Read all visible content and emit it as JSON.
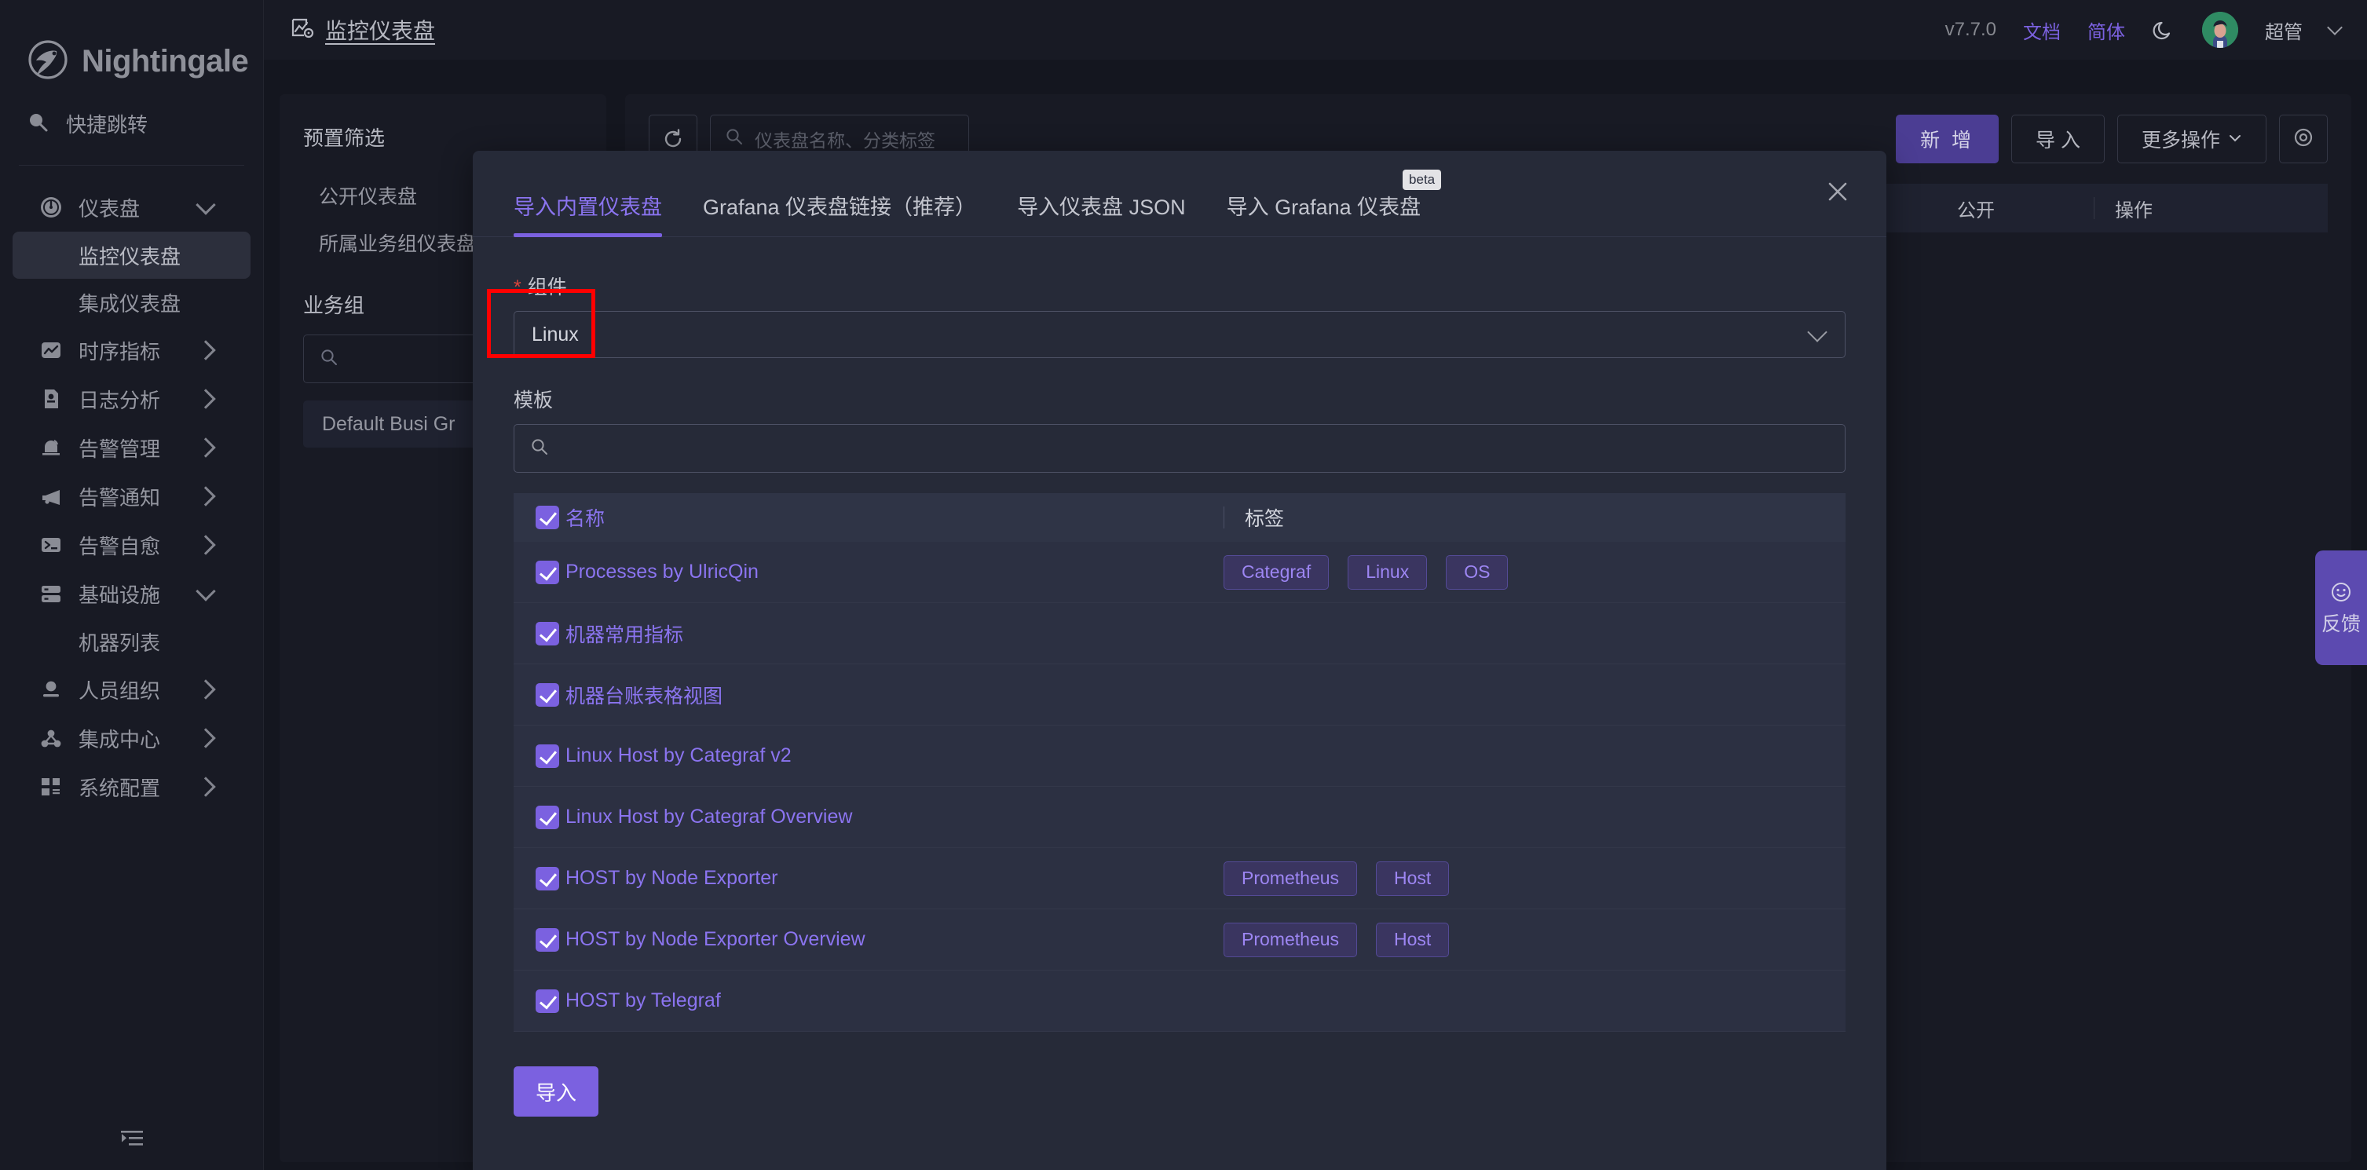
{
  "brand": {
    "name": "Nightingale"
  },
  "sidebar": {
    "quick_jump": "快捷跳转",
    "items": [
      {
        "label": "仪表盘",
        "icon": "gauge-icon",
        "arrow": "down"
      },
      {
        "label": "时序指标",
        "icon": "chart-line-icon",
        "arrow": "right"
      },
      {
        "label": "日志分析",
        "icon": "log-file-icon",
        "arrow": "right"
      },
      {
        "label": "告警管理",
        "icon": "alarm-bell-icon",
        "arrow": "right"
      },
      {
        "label": "告警通知",
        "icon": "megaphone-icon",
        "arrow": "right"
      },
      {
        "label": "告警自愈",
        "icon": "terminal-icon",
        "arrow": "right"
      },
      {
        "label": "基础设施",
        "icon": "server-icon",
        "arrow": "down"
      },
      {
        "label": "人员组织",
        "icon": "user-icon",
        "arrow": "right"
      },
      {
        "label": "集成中心",
        "icon": "integration-icon",
        "arrow": "right"
      },
      {
        "label": "系统配置",
        "icon": "grid-settings-icon",
        "arrow": "right"
      }
    ],
    "sub_dashboard": [
      "监控仪表盘",
      "集成仪表盘"
    ],
    "sub_infra": [
      "机器列表"
    ]
  },
  "header": {
    "page_title": "监控仪表盘",
    "version": "v7.7.0",
    "docs": "文档",
    "lang": "简体",
    "user": "超管"
  },
  "left_panel": {
    "preset_title": "预置筛选",
    "preset_items": [
      "公开仪表盘",
      "所属业务组仪表盘"
    ],
    "busigroup_title": "业务组",
    "busigroup_search_placeholder": "",
    "busigroup_row": "Default Busi Gr"
  },
  "right_panel": {
    "search_placeholder": "仪表盘名称、分类标签",
    "buttons": {
      "add": "新 增",
      "import": "导 入",
      "more": "更多操作",
      "eye": "eye-icon"
    },
    "columns": [
      "公开",
      "操作"
    ]
  },
  "feedback": {
    "label": "反馈",
    "icon": "smiley-icon"
  },
  "modal": {
    "tabs": [
      {
        "label": "导入内置仪表盘",
        "active": true,
        "badge": ""
      },
      {
        "label": "Grafana 仪表盘链接（推荐）",
        "active": false,
        "badge": ""
      },
      {
        "label": "导入仪表盘 JSON",
        "active": false,
        "badge": ""
      },
      {
        "label": "导入 Grafana 仪表盘",
        "active": false,
        "badge": "beta"
      }
    ],
    "component_label": "组件",
    "component_value": "Linux",
    "template_label": "模板",
    "template_search_placeholder": "",
    "table": {
      "col_name": "名称",
      "col_tags": "标签",
      "rows": [
        {
          "name": "Processes by UlricQin",
          "tags": [
            "Categraf",
            "Linux",
            "OS"
          ],
          "checked": true
        },
        {
          "name": "机器常用指标",
          "tags": [],
          "checked": true
        },
        {
          "name": "机器台账表格视图",
          "tags": [],
          "checked": true
        },
        {
          "name": "Linux Host by Categraf v2",
          "tags": [],
          "checked": true
        },
        {
          "name": "Linux Host by Categraf Overview",
          "tags": [],
          "checked": true
        },
        {
          "name": "HOST by Node Exporter",
          "tags": [
            "Prometheus",
            "Host"
          ],
          "checked": true
        },
        {
          "name": "HOST by Node Exporter Overview",
          "tags": [
            "Prometheus",
            "Host"
          ],
          "checked": true
        },
        {
          "name": "HOST by Telegraf",
          "tags": [],
          "checked": true
        }
      ]
    },
    "submit_label": "导入"
  },
  "colors": {
    "accent": "#7b61e0",
    "tag_text": "#9d86f3",
    "danger": "#d9453c",
    "annotation": "#ff0000"
  }
}
